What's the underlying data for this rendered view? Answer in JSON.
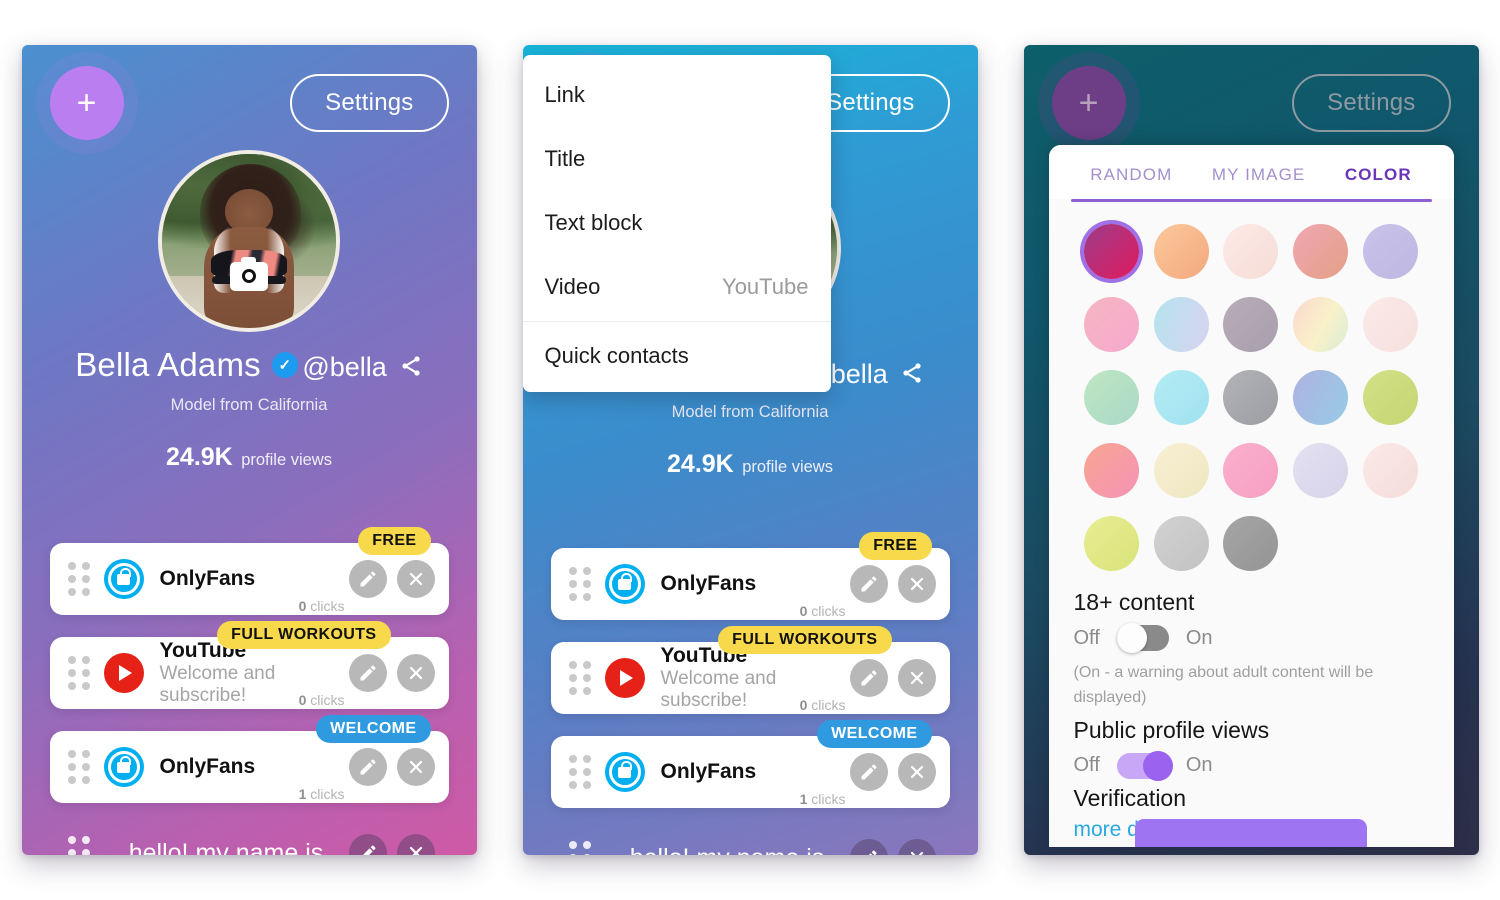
{
  "app": {
    "name": "Profile link-in-bio editor",
    "panels": 3
  },
  "shared": {
    "add_button_label": "+",
    "settings_button_label": "Settings",
    "profile": {
      "display_name": "Bella Adams",
      "verified_badge": "✓",
      "handle": "@bella",
      "bio": "Model from California",
      "views_count": "24.9K",
      "views_label": "profile views",
      "avatar_camera_icon": "camera-icon",
      "share_icon": "share-icon"
    },
    "cards": [
      {
        "icon": "onlyfans-lock-icon",
        "title": "OnlyFans",
        "subtitle": "",
        "clicks_count": "0",
        "clicks_label": "clicks",
        "badge": {
          "text": "FREE",
          "style": "yellow"
        },
        "edit_icon": "pencil-icon",
        "delete_icon": "close-icon"
      },
      {
        "icon": "youtube-play-icon",
        "title": "YouTube",
        "subtitle": "Welcome and subscribe!",
        "clicks_count": "0",
        "clicks_label": "clicks",
        "badge": {
          "text": "FULL WORKOUTS",
          "style": "yellow"
        },
        "edit_icon": "pencil-icon",
        "delete_icon": "close-icon"
      },
      {
        "icon": "onlyfans-lock-icon",
        "title": "OnlyFans",
        "subtitle": "",
        "clicks_count": "1",
        "clicks_label": "clicks",
        "badge": {
          "text": "WELCOME",
          "style": "blue"
        },
        "edit_icon": "pencil-icon",
        "delete_icon": "close-icon"
      }
    ],
    "text_block": {
      "label": "hello! my name is",
      "edit_icon": "pencil-icon",
      "delete_icon": "close-icon"
    },
    "drag_handle_icon": "drag-dots-icon"
  },
  "panel1": {
    "title": "Profile view",
    "background_gradient": [
      "#4a90cf",
      "#8b6ebd",
      "#cf5aa6"
    ]
  },
  "panel2": {
    "title": "Add block menu",
    "background_gradient": [
      "#17b6d8",
      "#3b8ccb",
      "#8b76bd"
    ],
    "menu": {
      "items": [
        {
          "label": "Link",
          "hint": ""
        },
        {
          "label": "Title",
          "hint": ""
        },
        {
          "label": "Text block",
          "hint": ""
        },
        {
          "label": "Video",
          "hint": "YouTube"
        },
        {
          "label": "Quick contacts",
          "hint": ""
        }
      ],
      "separator_before_index": 4
    }
  },
  "panel3": {
    "title": "Settings sheet",
    "background_gradient": [
      "#0d5f6b",
      "#1b4a62",
      "#2e2f48"
    ],
    "tabs": [
      {
        "label": "RANDOM",
        "active": false
      },
      {
        "label": "MY IMAGE",
        "active": false
      },
      {
        "label": "COLOR",
        "active": true
      }
    ],
    "accent_color": "#8d5fd3",
    "swatches": [
      {
        "index": 0,
        "color": "#d1216a",
        "gradient": "linear-gradient(135deg,#9c3d8a 0%,#e01a5e 100%)",
        "selected": true
      },
      {
        "index": 1,
        "color": "#f7b383",
        "gradient": "linear-gradient(135deg,#fbc99b 0%,#f3a87d 100%)",
        "selected": false
      },
      {
        "index": 2,
        "color": "#f7e0dc",
        "gradient": "linear-gradient(135deg,#fdeae6 0%,#f6dcd7 100%)",
        "selected": false
      },
      {
        "index": 3,
        "color": "#eba8a2",
        "gradient": "linear-gradient(135deg,#f0a7b2 0%,#e3a086 100%)",
        "selected": false
      },
      {
        "index": 4,
        "color": "#c2bde4",
        "gradient": "linear-gradient(135deg,#c9c3ec 0%,#bdb7e1 100%)",
        "selected": false
      },
      {
        "index": 5,
        "color": "#f5aec6",
        "gradient": "linear-gradient(135deg,#f6b6c0 0%,#f7a8d0 100%)",
        "selected": false
      },
      {
        "index": 6,
        "color": "#bfe0ee",
        "gradient": "linear-gradient(110deg,#b4e4ee 0%,#d9d2f0 100%)",
        "selected": false
      },
      {
        "index": 7,
        "color": "#b1a5b2",
        "gradient": "linear-gradient(135deg,#b9acb8 0%,#a99ead 100%)",
        "selected": false
      },
      {
        "index": 8,
        "color": "#f6ddd0",
        "gradient": "linear-gradient(120deg,#fbd9cd 0%,#f9f1c9 55%,#d7ecd6 100%)",
        "selected": false
      },
      {
        "index": 9,
        "color": "#f8e6e4",
        "gradient": "linear-gradient(135deg,#fbeae8 0%,#f6e0de 100%)",
        "selected": false
      },
      {
        "index": 10,
        "color": "#b3dfbd",
        "gradient": "linear-gradient(135deg,#bfe6c3 0%,#a9d9c6 100%)",
        "selected": false
      },
      {
        "index": 11,
        "color": "#a8e8f2",
        "gradient": "linear-gradient(135deg,#b4ecf4 0%,#9fe2f0 100%)",
        "selected": false
      },
      {
        "index": 12,
        "color": "#a7a9ad",
        "gradient": "linear-gradient(135deg,#b2b4b8 0%,#9b9da2 100%)",
        "selected": false
      },
      {
        "index": 13,
        "color": "#a6bfe0",
        "gradient": "linear-gradient(120deg,#aeb2e0 0%,#97cbe6 100%)",
        "selected": false
      },
      {
        "index": 14,
        "color": "#ccdc7c",
        "gradient": "linear-gradient(135deg,#d4e087 0%,#c4d673 100%)",
        "selected": false
      },
      {
        "index": 15,
        "color": "#f69fb2",
        "gradient": "linear-gradient(135deg,#f7a591 0%,#f593b6 100%)",
        "selected": false
      },
      {
        "index": 16,
        "color": "#f3ecc9",
        "gradient": "linear-gradient(135deg,#f7efd2 0%,#efe7c1 100%)",
        "selected": false
      },
      {
        "index": 17,
        "color": "#f8a8c8",
        "gradient": "linear-gradient(135deg,#fbb0cd 0%,#f59fc2 100%)",
        "selected": false
      },
      {
        "index": 18,
        "color": "#dedaee",
        "gradient": "linear-gradient(135deg,#e5e1f2 0%,#d6d2e9 100%)",
        "selected": false
      },
      {
        "index": 19,
        "color": "#f7e3e1",
        "gradient": "linear-gradient(135deg,#fbeae8 0%,#f4dcda 100%)",
        "selected": false
      },
      {
        "index": 20,
        "color": "#e0e985",
        "gradient": "linear-gradient(135deg,#e6ee91 0%,#d9e37a 100%)",
        "selected": false
      },
      {
        "index": 21,
        "color": "#c9c9c9",
        "gradient": "linear-gradient(135deg,#d2d2d2 0%,#c2c2c2 100%)",
        "selected": false
      },
      {
        "index": 22,
        "color": "#9c9c9c",
        "gradient": "linear-gradient(135deg,#a6a6a6 0%,#949494 100%)",
        "selected": false
      }
    ],
    "settings": {
      "adult_content": {
        "title": "18+ content",
        "off_label": "Off",
        "on_label": "On",
        "state": "off",
        "note": "(On - a warning about adult content will be displayed)"
      },
      "public_profile_views": {
        "title": "Public profile views",
        "off_label": "Off",
        "on_label": "On",
        "state": "on"
      },
      "verification": {
        "title": "Verification",
        "link_label": "more details ..."
      }
    }
  }
}
